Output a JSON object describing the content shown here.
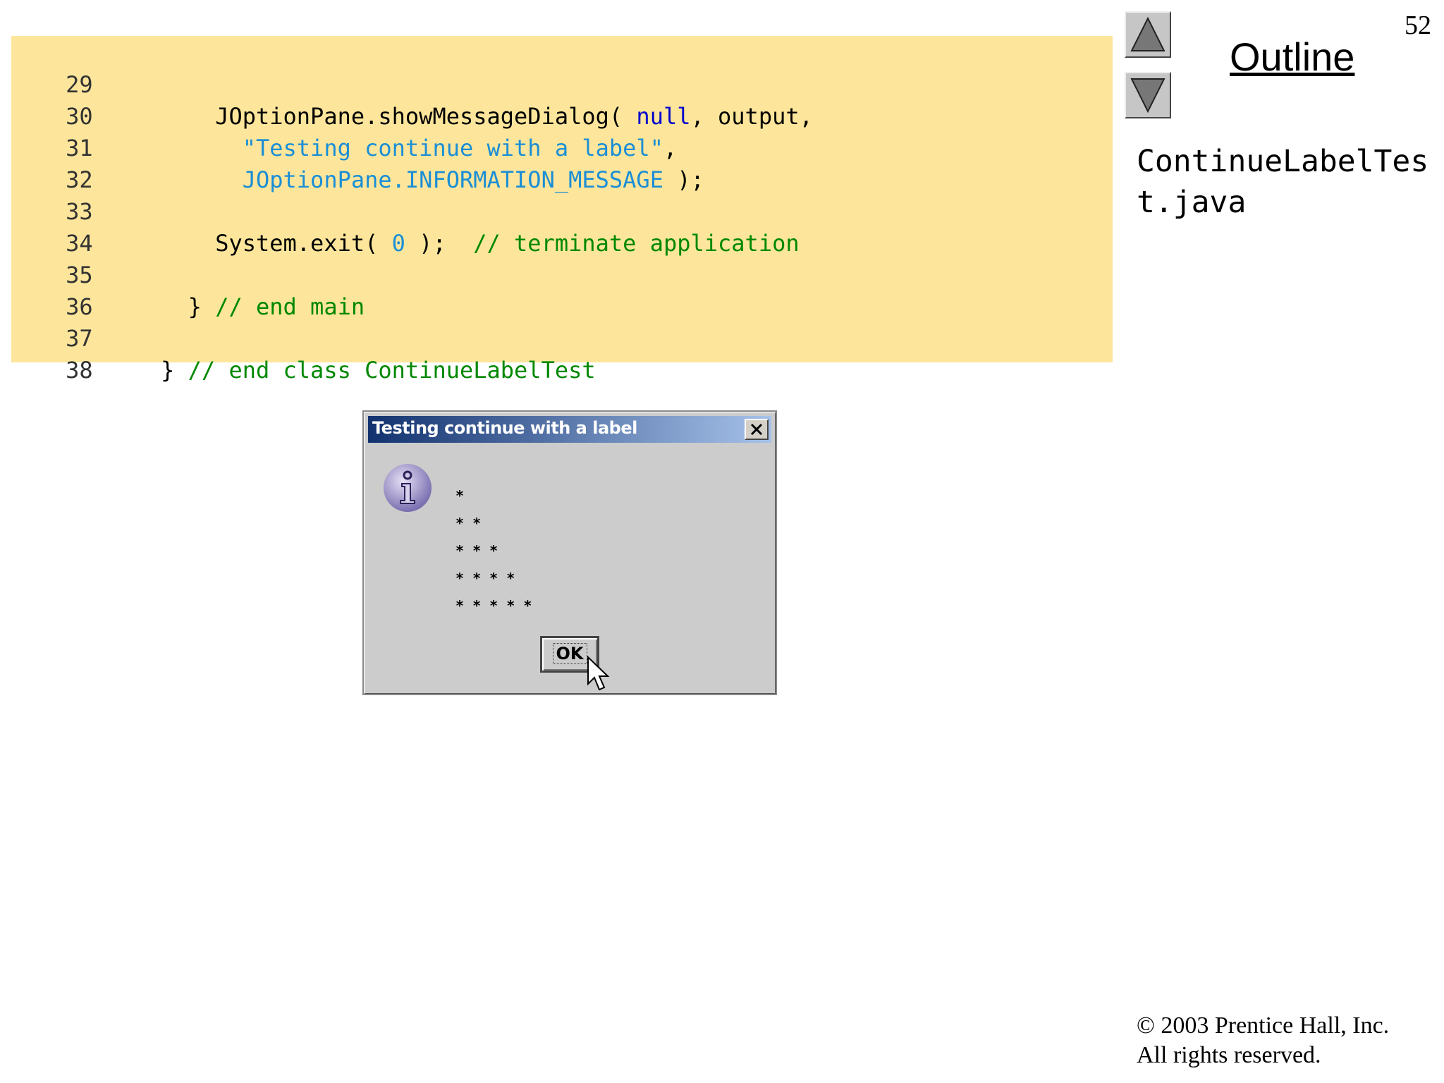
{
  "page_number": "52",
  "outline_title": "Outline",
  "file_name": "ContinueLabelTest.java",
  "code_lines": [
    {
      "no": "29"
    },
    {
      "no": "30",
      "a": "        JOptionPane.showMessageDialog( ",
      "b": "null",
      "c": ", output,"
    },
    {
      "no": "31",
      "a": "          ",
      "b": "\"Testing continue with a label\"",
      "c": ","
    },
    {
      "no": "32",
      "a": "          ",
      "b": "JOptionPane.INFORMATION_MESSAGE",
      "c": " );"
    },
    {
      "no": "33"
    },
    {
      "no": "34",
      "a": "        System.exit( ",
      "b": "0",
      "c": " );  ",
      "d": "// terminate application"
    },
    {
      "no": "35"
    },
    {
      "no": "36",
      "a": "      } ",
      "d": "// end main"
    },
    {
      "no": "37"
    },
    {
      "no": "38",
      "a": "    } ",
      "d": "// end class ContinueLabelTest"
    }
  ],
  "dialog": {
    "title": "Testing continue with a label",
    "stars": [
      "*",
      "* *",
      "* * *",
      "* * * *",
      "* * * * *"
    ],
    "ok_label": "OK"
  },
  "copyright": {
    "line1": "© 2003 Prentice Hall, Inc.",
    "line2": "All rights reserved."
  },
  "colors": {
    "code_bg": "#fde69b",
    "keyword": "#0000cc",
    "string": "#1a8ed6",
    "comment": "#008800",
    "title_bar_start": "#12326f",
    "title_bar_end": "#a6c2ea"
  }
}
